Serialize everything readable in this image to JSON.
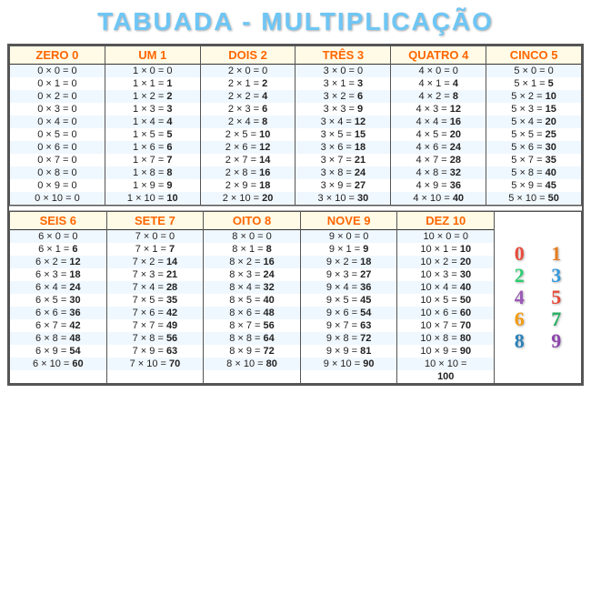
{
  "title": "TABUADA - MULTIPLICAÇÃO",
  "sections_row1": [
    {
      "header": "ZERO 0",
      "rows": [
        "0 × 0 = 0",
        "0 × 1 = 0",
        "0 × 2 = 0",
        "0 × 3 = 0",
        "0 × 4 = 0",
        "0 × 5 = 0",
        "0 × 6 = 0",
        "0 × 7 = 0",
        "0 × 8 = 0",
        "0 × 9 = 0",
        "0 × 10 = 0"
      ],
      "bolds": [
        false,
        false,
        false,
        false,
        false,
        false,
        false,
        false,
        false,
        false,
        false
      ]
    },
    {
      "header": "UM 1",
      "rows": [
        "1 × 0 = 0",
        "1 × 1 = 1",
        "1 × 2 = 2",
        "1 × 3 = 3",
        "1 × 4 = 4",
        "1 × 5 = 5",
        "1 × 6 = 6",
        "1 × 7 = 7",
        "1 × 8 = 8",
        "1 × 9 = 9",
        "1 × 10 = 10"
      ],
      "bolds": [
        false,
        true,
        true,
        true,
        true,
        true,
        true,
        true,
        true,
        true,
        true
      ]
    },
    {
      "header": "DOIS 2",
      "rows": [
        "2 × 0 = 0",
        "2 × 1 = 2",
        "2 × 2 = 4",
        "2 × 3 = 6",
        "2 × 4 = 8",
        "2 × 5 = 10",
        "2 × 6 = 12",
        "2 × 7 = 14",
        "2 × 8 = 16",
        "2 × 9 = 18",
        "2 × 10 = 20"
      ],
      "bolds": [
        false,
        true,
        true,
        true,
        true,
        true,
        true,
        true,
        true,
        true,
        true
      ]
    },
    {
      "header": "TRÊS 3",
      "rows": [
        "3 × 0 = 0",
        "3 × 1 = 3",
        "3 × 2 = 6",
        "3 × 3 = 9",
        "3 × 4 = 12",
        "3 × 5 = 15",
        "3 × 6 = 18",
        "3 × 7 = 21",
        "3 × 8 = 24",
        "3 × 9 = 27",
        "3 × 10 = 30"
      ],
      "bolds": [
        false,
        true,
        true,
        true,
        true,
        true,
        true,
        true,
        true,
        true,
        true
      ]
    },
    {
      "header": "QUATRO 4",
      "rows": [
        "4 × 0 = 0",
        "4 × 1 = 4",
        "4 × 2 = 8",
        "4 × 3 = 12",
        "4 × 4 = 16",
        "4 × 5 = 20",
        "4 × 6 = 24",
        "4 × 7 = 28",
        "4 × 8 = 32",
        "4 × 9 = 36",
        "4 × 10 = 40"
      ],
      "bolds": [
        false,
        true,
        true,
        true,
        true,
        true,
        true,
        true,
        true,
        true,
        true
      ]
    },
    {
      "header": "CINCO 5",
      "rows": [
        "5 × 0 = 0",
        "5 × 1 = 5",
        "5 × 2 = 10",
        "5 × 3 = 15",
        "5 × 4 = 20",
        "5 × 5 = 25",
        "5 × 6 = 30",
        "5 × 7 = 35",
        "5 × 8 = 40",
        "5 × 9 = 45",
        "5 × 10 = 50"
      ],
      "bolds": [
        false,
        true,
        true,
        true,
        true,
        true,
        true,
        true,
        true,
        true,
        true
      ]
    }
  ],
  "sections_row2": [
    {
      "header": "SEIS 6",
      "rows": [
        "6 × 0 = 0",
        "6 × 1 = 6",
        "6 × 2 = 12",
        "6 × 3 = 18",
        "6 × 4 = 24",
        "6 × 5 = 30",
        "6 × 6 = 36",
        "6 × 7 = 42",
        "6 × 8 = 48",
        "6 × 9 = 54",
        "6 × 10 = 60"
      ],
      "bolds": [
        false,
        true,
        true,
        true,
        true,
        true,
        true,
        true,
        true,
        true,
        true
      ]
    },
    {
      "header": "SETE 7",
      "rows": [
        "7 × 0 = 0",
        "7 × 1 = 7",
        "7 × 2 = 14",
        "7 × 3 = 21",
        "7 × 4 = 28",
        "7 × 5 = 35",
        "7 × 6 = 42",
        "7 × 7 = 49",
        "7 × 8 = 56",
        "7 × 9 = 63",
        "7 × 10 = 70"
      ],
      "bolds": [
        false,
        true,
        true,
        true,
        true,
        true,
        true,
        true,
        true,
        true,
        true
      ]
    },
    {
      "header": "OITO 8",
      "rows": [
        "8 × 0 = 0",
        "8 × 1 = 8",
        "8 × 2 = 16",
        "8 × 3 = 24",
        "8 × 4 = 32",
        "8 × 5 = 40",
        "8 × 6 = 48",
        "8 × 7 = 56",
        "8 × 8 = 64",
        "8 × 9 = 72",
        "8 × 10 = 80"
      ],
      "bolds": [
        false,
        true,
        true,
        true,
        true,
        true,
        true,
        true,
        true,
        true,
        true
      ]
    },
    {
      "header": "NOVE 9",
      "rows": [
        "9 × 0 = 0",
        "9 × 1 = 9",
        "9 × 2 = 18",
        "9 × 3 = 27",
        "9 × 4 = 36",
        "9 × 5 = 45",
        "9 × 6 = 54",
        "9 × 7 = 63",
        "9 × 8 = 72",
        "9 × 9 = 81",
        "9 × 10 = 90"
      ],
      "bolds": [
        false,
        true,
        true,
        true,
        true,
        true,
        true,
        true,
        true,
        true,
        true
      ]
    },
    {
      "header": "DEZ 10",
      "rows": [
        "10 × 0 = 0",
        "10 × 1 = 10",
        "10 × 2 = 20",
        "10 × 3 = 30",
        "10 × 4 = 40",
        "10 × 5 = 50",
        "10 × 6 = 60",
        "10 × 7 = 70",
        "10 × 8 = 80",
        "10 × 9 = 90",
        "10 × 10 ="
      ],
      "extra_row": "100",
      "bolds": [
        false,
        true,
        true,
        true,
        true,
        true,
        true,
        true,
        true,
        true,
        true
      ]
    }
  ]
}
